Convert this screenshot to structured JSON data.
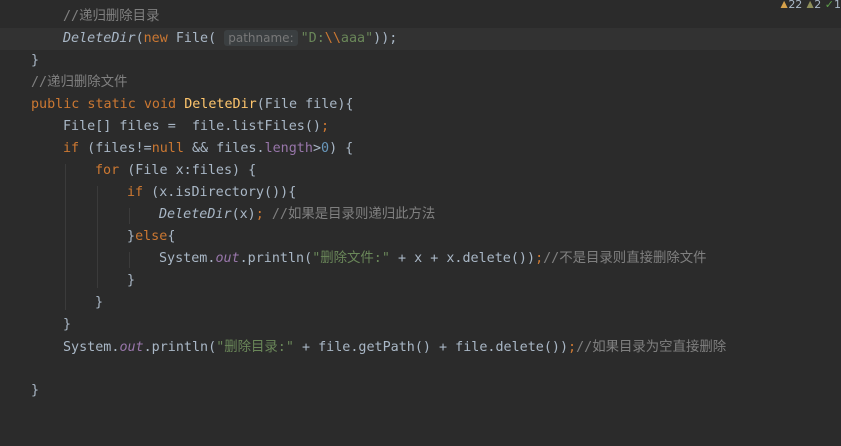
{
  "inspection": {
    "warnings": "22",
    "weak_warnings": "2",
    "typos": "1"
  },
  "code": {
    "l1_comment": "//递归删除目录",
    "l2_call": "DeleteDir",
    "l2_open": "(",
    "l2_new": "new",
    "l2_type": " File(",
    "l2_hint": "pathname:",
    "l2_str_a": "\"D:",
    "l2_escape": "\\\\",
    "l2_str_b": "aaa\"",
    "l2_close": "));",
    "l3_brace": "}",
    "l4_comment": "//递归删除文件",
    "l5_mod": "public static void ",
    "l5_name": "DeleteDir",
    "l5_params": "(File file){",
    "l6_decl": "File[] files =  file.listFiles()",
    "l6_semi": ";",
    "l7_if": "if",
    "l7_a": " (files!=",
    "l7_null": "null",
    "l7_b": " && files.",
    "l7_length": "length",
    "l7_c": ">",
    "l7_zero": "0",
    "l7_d": ") {",
    "l8_for": "for",
    "l8_rest": " (File x:files) {",
    "l9_if": "if",
    "l9_rest": " (x.isDirectory()){",
    "l10_call": "DeleteDir",
    "l10_args": "(x)",
    "l10_semi": "; ",
    "l10_comment": "//如果是目录则递归此方法",
    "l11_close": "}",
    "l11_else": "else",
    "l11_open": "{",
    "l12_sys": "System.",
    "l12_out": "out",
    "l12_call": ".println(",
    "l12_str": "\"删除文件:\"",
    "l12_rest": " + x + x.delete())",
    "l12_semi": ";",
    "l12_comment": "//不是目录则直接删除文件",
    "l13_brace": "}",
    "l14_brace": "}",
    "l15_brace": "}",
    "l16_sys": "System.",
    "l16_out": "out",
    "l16_call": ".println(",
    "l16_str": "\"删除目录:\"",
    "l16_rest": " + file.getPath() + file.delete())",
    "l16_semi": ";",
    "l16_comment": "//如果目录为空直接删除",
    "l18_brace": "}"
  }
}
